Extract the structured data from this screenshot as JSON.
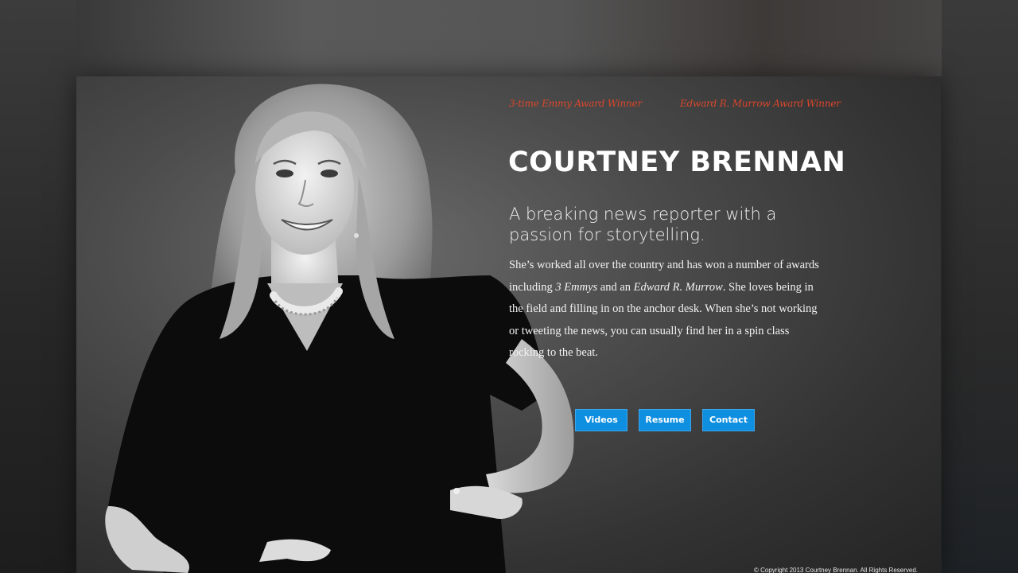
{
  "awards": {
    "first": "3-time Emmy Award Winner",
    "second": "Edward R. Murrow Award Winner"
  },
  "hero": {
    "name": "COURTNEY BRENNAN",
    "tagline": "A breaking news reporter with a passion for storytelling.",
    "bio": {
      "part1": "She’s worked all over the country and has won a number of awards including ",
      "em1": "3 Emmys",
      "part2": " and an ",
      "em2": "Edward R. Murrow",
      "part3": ". She loves being in the field and filling in on the anchor desk. When she’s not working or tweeting the news, you can usually find her in a spin class rocking to the beat."
    }
  },
  "buttons": {
    "videos": "Videos",
    "resume": "Resume",
    "contact": "Contact"
  },
  "footer": {
    "copyright": "© Copyright 2013 Courtney Brennan. All Rights Reserved."
  },
  "colors": {
    "accent": "#d9472c",
    "button": "#0f8fe0"
  }
}
